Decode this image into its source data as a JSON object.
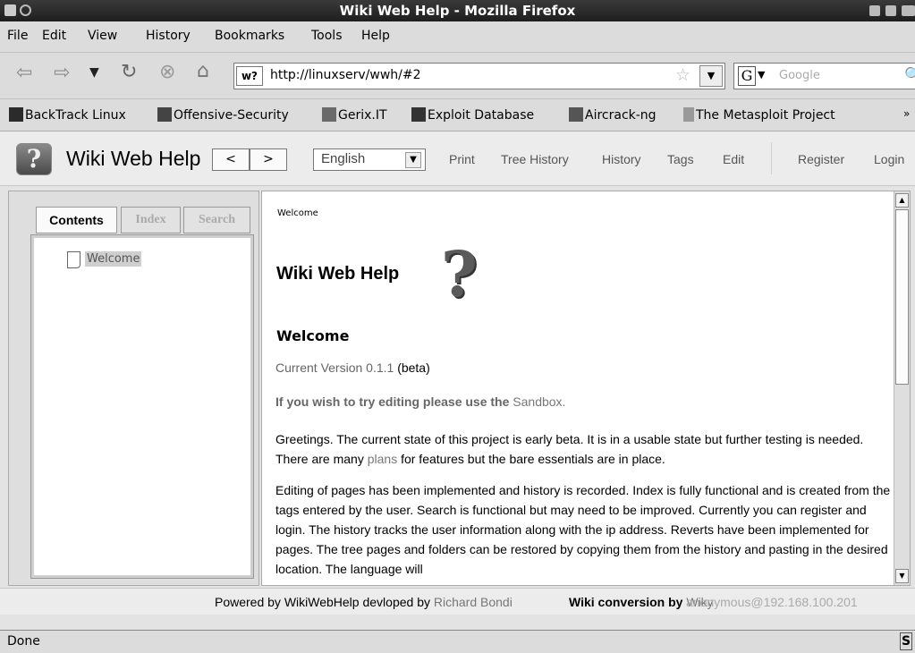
{
  "window": {
    "title": "Wiki Web Help - Mozilla Firefox"
  },
  "menu": {
    "file": "File",
    "edit": "Edit",
    "view": "View",
    "history": "History",
    "bookmarks": "Bookmarks",
    "tools": "Tools",
    "help": "Help"
  },
  "nav": {
    "site_icon_text": "w?",
    "url": "http://linuxserv/wwh/#2",
    "search_engine": "G",
    "search_placeholder": "Google"
  },
  "bookmarks_bar": {
    "items": [
      {
        "label": "BackTrack Linux",
        "color": "#2b2b2b"
      },
      {
        "label": "Offensive-Security",
        "color": "#444444"
      },
      {
        "label": "Gerix.IT",
        "color": "#6a6a6a"
      },
      {
        "label": "Exploit Database",
        "color": "#333333"
      },
      {
        "label": "Aircrack-ng",
        "color": "#555555"
      },
      {
        "label": "The Metasploit Project",
        "color": "#999999"
      }
    ],
    "overflow": "»"
  },
  "wiki": {
    "logo_text": "?",
    "title": "Wiki Web Help",
    "back_label": "<",
    "forward_label": ">",
    "language": "English",
    "links": {
      "print": "Print",
      "tree_history": "Tree History",
      "history": "History",
      "tags": "Tags",
      "edit": "Edit",
      "register": "Register",
      "login": "Login"
    },
    "tabs": {
      "contents": "Contents",
      "index": "Index",
      "search": "Search"
    },
    "tree": {
      "item": "Welcome"
    }
  },
  "content": {
    "breadcrumb": "Welcome",
    "heading": "Wiki Web Help",
    "section": "Welcome",
    "version_label": "Current Version 0.1.1",
    "version_tag": "(beta)",
    "sandbox_text": "If you wish to try editing please use the",
    "sandbox_link": "Sandbox.",
    "p1_a": "Greetings. The current state of this project is early beta. It is in a usable state but further testing is needed. There are many",
    "p1_link": "plans",
    "p1_b": "for features but the bare essentials are in place.",
    "p2": "Editing of pages has been implemented and history is recorded. Index is fully functional and is created from the tags entered by the user. Search is functional but may need to be improved. Currently you can register and login. The history tracks the user information along with the ip address. Reverts have been implemented for pages. The tree pages and folders can be restored by copying them from the history and pasting in the desired location. The language will"
  },
  "footer": {
    "powered_prefix": "Powered by WikiWebHelp devloped by",
    "powered_author": "Richard Bondi",
    "conversion_prefix": "Wiki conversion by",
    "conversion_link": "Wiky",
    "user": "anonymous@192.168.100.201"
  },
  "status": {
    "text": "Done",
    "icon_text": "S"
  }
}
